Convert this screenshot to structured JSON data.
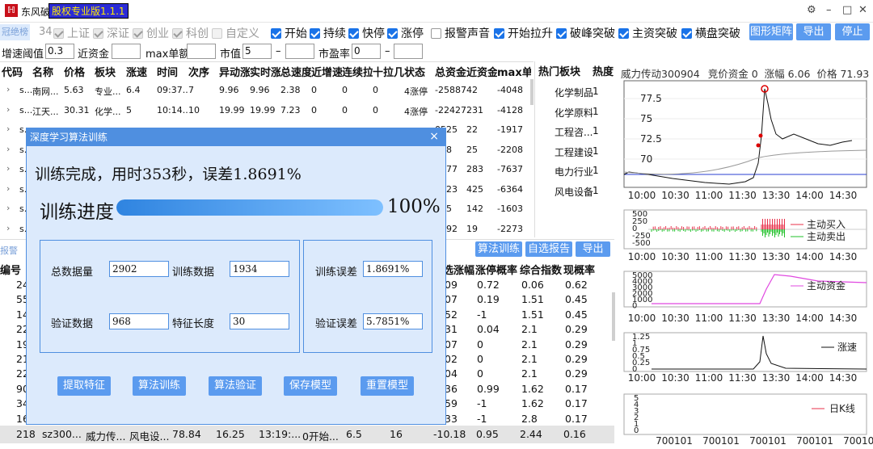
{
  "app": {
    "name": "东风破",
    "version_badge": "股权专业版1.1.1",
    "logo_char": "ℍ"
  },
  "window_controls": {
    "settings": "⚙",
    "minimize": "–",
    "maximize": "□",
    "close": "✕"
  },
  "toolbar": {
    "tag_left": "冠绝榜",
    "count": "34",
    "market_filters": [
      {
        "label": "上证",
        "checked": true,
        "disabled": true
      },
      {
        "label": "深证",
        "checked": true,
        "disabled": true
      },
      {
        "label": "创业",
        "checked": true,
        "disabled": true
      },
      {
        "label": "科创",
        "checked": true,
        "disabled": true
      },
      {
        "label": "自定义",
        "checked": false,
        "disabled": true
      }
    ],
    "signal_filters": [
      {
        "label": "开始",
        "checked": true
      },
      {
        "label": "持续",
        "checked": true
      },
      {
        "label": "快停",
        "checked": true
      },
      {
        "label": "涨停",
        "checked": true
      },
      {
        "label": "报警声音",
        "checked": false
      },
      {
        "label": "开始拉升",
        "checked": true
      },
      {
        "label": "破峰突破",
        "checked": true
      },
      {
        "label": "主资突破",
        "checked": true
      },
      {
        "label": "横盘突破",
        "checked": true
      }
    ],
    "buttons": {
      "matrix": "图形矩阵",
      "export": "导出",
      "stop": "停止"
    }
  },
  "filters": {
    "speed_label": "增速阈值",
    "speed_value": "0.3",
    "funds_label": "近资金",
    "funds_value": "",
    "max_label": "max单额",
    "max_value": "",
    "mcap_label": "市值",
    "mcap_min": "5",
    "mcap_dash": "–",
    "mcap_max": "",
    "pe_label": "市盈率",
    "pe_min": "0",
    "pe_dash": "–",
    "pe_max": ""
  },
  "main_table": {
    "headers": [
      "代码",
      "名称",
      "价格",
      "板块",
      "涨速",
      "时间",
      "次序",
      "异动涨",
      "实时涨",
      "总速度",
      "近增速",
      "连续拉",
      "十拉几",
      "状态",
      "总资金",
      "近资金",
      "max单"
    ],
    "rows": [
      [
        "s...",
        "南网...",
        "5.63",
        "专业...",
        "6.4",
        "09:37...",
        "7",
        "9.96",
        "9.96",
        "2.38",
        "0",
        "0",
        "0",
        "4涨停",
        "-25887",
        "42",
        "-4048"
      ],
      [
        "s...",
        "江天...",
        "30.31",
        "化学...",
        "5",
        "10:14...",
        "10",
        "19.99",
        "19.99",
        "7.23",
        "0",
        "0",
        "0",
        "4涨停",
        "-22427",
        "231",
        "-4128"
      ],
      [
        "s...",
        "",
        "",
        "",
        "",
        "",
        "",
        "",
        "",
        "",
        "",
        "",
        "",
        "",
        "0525",
        "22",
        "-1917"
      ],
      [
        "s...",
        "",
        "",
        "",
        "",
        "",
        "",
        "",
        "",
        "",
        "",
        "",
        "",
        "",
        "358",
        "25",
        "-2208"
      ],
      [
        "s...",
        "",
        "",
        "",
        "",
        "",
        "",
        "",
        "",
        "",
        "",
        "",
        "",
        "",
        "7977",
        "283",
        "-7637"
      ],
      [
        "s...",
        "",
        "",
        "",
        "",
        "",
        "",
        "",
        "",
        "",
        "",
        "",
        "",
        "",
        "3223",
        "425",
        "-6364"
      ],
      [
        "s...",
        "",
        "",
        "",
        "",
        "",
        "",
        "",
        "",
        "",
        "",
        "",
        "",
        "",
        "965",
        "142",
        "-1603"
      ],
      [
        "s...",
        "",
        "",
        "",
        "",
        "",
        "",
        "",
        "",
        "",
        "",
        "",
        "",
        "",
        "8492",
        "19",
        "-2273"
      ]
    ]
  },
  "sectors": {
    "headers": [
      "热门板块",
      "热度"
    ],
    "rows": [
      [
        "化学制品",
        "1"
      ],
      [
        "化学原料",
        "1"
      ],
      [
        "工程咨...",
        "1"
      ],
      [
        "工程建设",
        "1"
      ],
      [
        "电力行业",
        "1"
      ],
      [
        "风电设备",
        "1"
      ]
    ]
  },
  "stock_header": {
    "name_code": "威力传动300904",
    "auction_label": "竞价资金",
    "auction_value": "0",
    "change_label": "涨幅",
    "change_value": "6.06",
    "price_label": "价格",
    "price_value": "71.93"
  },
  "bottom_panel": {
    "tab_left": "报警",
    "left_header": "编号",
    "buttons": {
      "train": "算法训练",
      "self_report": "自选报告",
      "export": "导出"
    },
    "right_headers": [
      "选涨幅",
      "涨停概率",
      "综合指数",
      "现概率"
    ],
    "left_nums": [
      "24",
      "55",
      "14",
      "22",
      "19",
      "21",
      "22",
      "90",
      "34",
      "16"
    ],
    "right_rows": [
      [
        "09",
        "0.72",
        "0.06",
        "0.62"
      ],
      [
        "07",
        "0.19",
        "1.51",
        "0.45"
      ],
      [
        "52",
        "-1",
        "1.51",
        "0.45"
      ],
      [
        "31",
        "0.04",
        "2.1",
        "0.29"
      ],
      [
        "07",
        "0",
        "2.1",
        "0.29"
      ],
      [
        "02",
        "0",
        "2.1",
        "0.29"
      ],
      [
        "04",
        "0",
        "2.1",
        "0.29"
      ],
      [
        "36",
        "0.99",
        "1.62",
        "0.17"
      ],
      [
        "59",
        "-1",
        "1.62",
        "0.17"
      ],
      [
        "33",
        "-1",
        "2.8",
        "0.17"
      ]
    ],
    "last_row": [
      "218",
      "sz300...",
      "威力传...",
      "风电设...",
      "78.84",
      "16.25",
      "13:19:...",
      "0开始...",
      "6.5",
      "16",
      "-10.18",
      "0.95",
      "2.44",
      "0.16"
    ]
  },
  "dialog": {
    "title": "深度学习算法训练",
    "close": "×",
    "status": "训练完成，用时353秒，误差1.8691%",
    "progress_label": "训练进度",
    "progress_pct_text": "100%",
    "progress_value": 1.0,
    "fields": {
      "total_label": "总数据量",
      "total_value": "2902",
      "train_label": "训练数据",
      "train_value": "1934",
      "valid_label": "验证数据",
      "valid_value": "968",
      "feat_label": "特征长度",
      "feat_value": "30",
      "train_err_label": "训练误差",
      "train_err_value": "1.8691%",
      "valid_err_label": "验证误差",
      "valid_err_value": "5.7851%"
    },
    "buttons": [
      "提取特征",
      "算法训练",
      "算法验证",
      "保存模型",
      "重置模型"
    ]
  },
  "price_chart": {
    "y_ticks": [
      "77.5",
      "75",
      "72.5",
      "70"
    ],
    "x_ticks": [
      "10:00",
      "10:30",
      "11:00",
      "11:30",
      "13:30",
      "14:00",
      "14:30"
    ]
  },
  "flow_chart": {
    "y_ticks": [
      "500",
      "250",
      "0",
      "-250",
      "-500"
    ],
    "legend": [
      "主动买入",
      "主动卖出"
    ],
    "x_ticks": [
      "10:00",
      "10:30",
      "11:00",
      "11:30",
      "13:30",
      "14:00",
      "14:30"
    ]
  },
  "funds_chart": {
    "y_ticks": [
      "5000",
      "4000",
      "3000",
      "2000",
      "1000",
      "0"
    ],
    "legend": "主动资金",
    "x_ticks": [
      "10:00",
      "10:30",
      "11:00",
      "11:30",
      "13:30",
      "14:00",
      "14:30"
    ]
  },
  "speed_chart": {
    "y_ticks": [
      "1.25",
      "1",
      "0.75",
      "0.5",
      "0.25",
      "0"
    ],
    "legend": "涨速",
    "x_ticks": [
      "10:00",
      "10:30",
      "11:00",
      "11:30",
      "13:30",
      "14:00",
      "14:30"
    ]
  },
  "kline_chart": {
    "y_ticks": [
      "5",
      "4",
      "3",
      "2",
      "1",
      "0"
    ],
    "legend": "日K线",
    "x_ticks": [
      "700101",
      "700101",
      "700101",
      "700101",
      "700101"
    ]
  },
  "colors": {
    "accent": "#5b9bef",
    "dialog_bg": "#dceafc",
    "progress": "#3a8ee6",
    "buy": "#e8304a",
    "sell": "#22c02a",
    "funds": "#e048e0"
  }
}
